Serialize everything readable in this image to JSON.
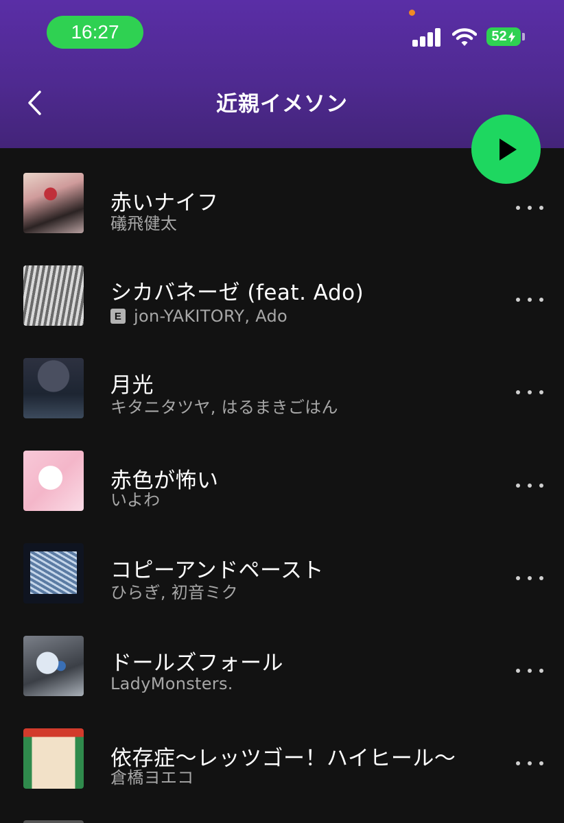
{
  "status_bar": {
    "time": "16:27",
    "battery": "52"
  },
  "header": {
    "title": "近親イメソン"
  },
  "tracks": [
    {
      "title": "赤いナイフ",
      "artist": "礒飛健太",
      "explicit": false
    },
    {
      "title": "シカバネーゼ (feat. Ado)",
      "artist": "jon-YAKITORY, Ado",
      "explicit": true,
      "explicit_badge": "E"
    },
    {
      "title": "月光",
      "artist": "キタニタツヤ, はるまきごはん",
      "explicit": false
    },
    {
      "title": "赤色が怖い",
      "artist": "いよわ",
      "explicit": false
    },
    {
      "title": "コピーアンドペースト",
      "artist": "ひらぎ, 初音ミク",
      "explicit": false
    },
    {
      "title": "ドールズフォール",
      "artist": "LadyMonsters.",
      "explicit": false
    },
    {
      "title": "依存症〜レッツゴー！ハイヒール〜",
      "artist": "倉橋ヨエコ",
      "explicit": false
    }
  ],
  "colors": {
    "accent": "#1ed760",
    "header": "#5a2ea6",
    "background": "#121212"
  },
  "icons": [
    "chevron-left-icon",
    "play-icon",
    "more-icon",
    "signal-icon",
    "wifi-icon",
    "battery-icon"
  ]
}
